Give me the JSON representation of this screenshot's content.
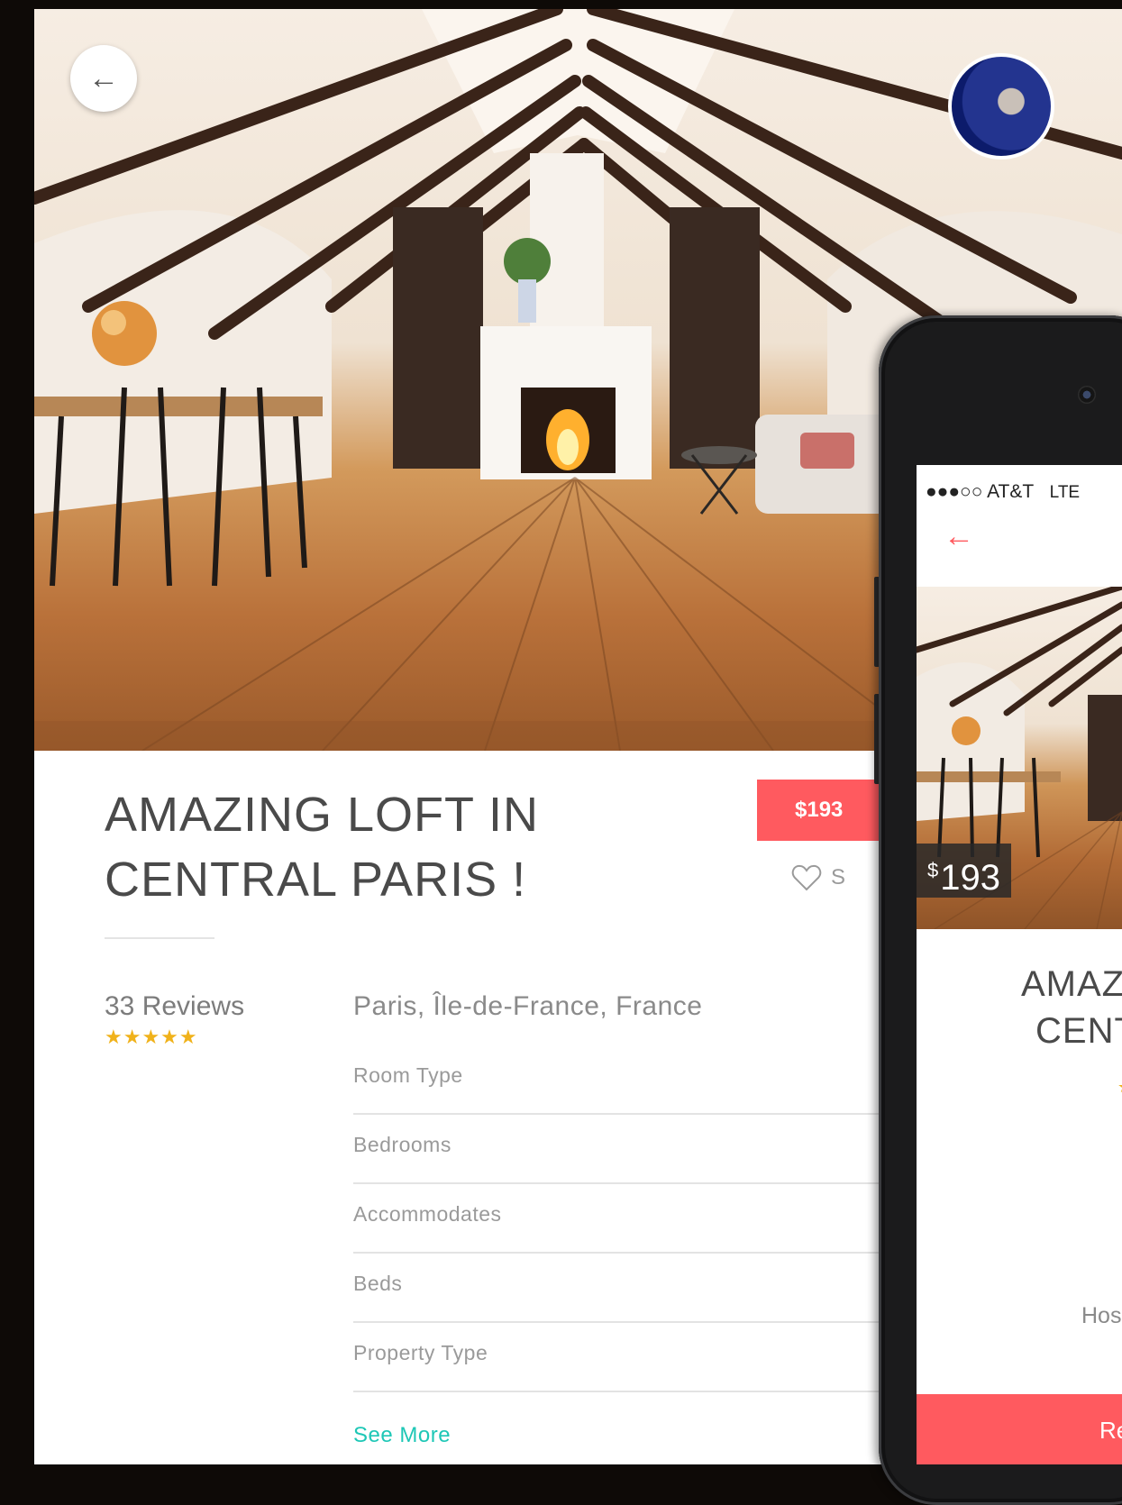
{
  "listing": {
    "title_line1": "AMAZING LOFT IN",
    "title_line2": "CENTRAL PARIS !",
    "price_label": "$193",
    "save_label": "S",
    "reviews_label": "33 Reviews",
    "rating_stars": 5,
    "stars_text": "★★★★★",
    "location": "Paris, Île-de-France, France",
    "properties": [
      "Room Type",
      "Bedrooms",
      "Accommodates",
      "Beds",
      "Property Type"
    ],
    "see_more_label": "See More"
  },
  "icons": {
    "back": "back-arrow-icon",
    "heart": "heart-icon",
    "avatar": "host-avatar"
  },
  "phone": {
    "status_carrier": "●●●○○ AT&T",
    "status_network": "LTE",
    "back_arrow": "←",
    "price_currency": "$",
    "price_value": "193",
    "title_line1": "AMAZ",
    "title_line2": "CENT",
    "host_label": "Hos",
    "cta_label": "Re"
  },
  "colors": {
    "accent": "#ff5a5f",
    "link": "#1ec7b6",
    "stars": "#f0b21b",
    "text": "#4a4a4a"
  }
}
